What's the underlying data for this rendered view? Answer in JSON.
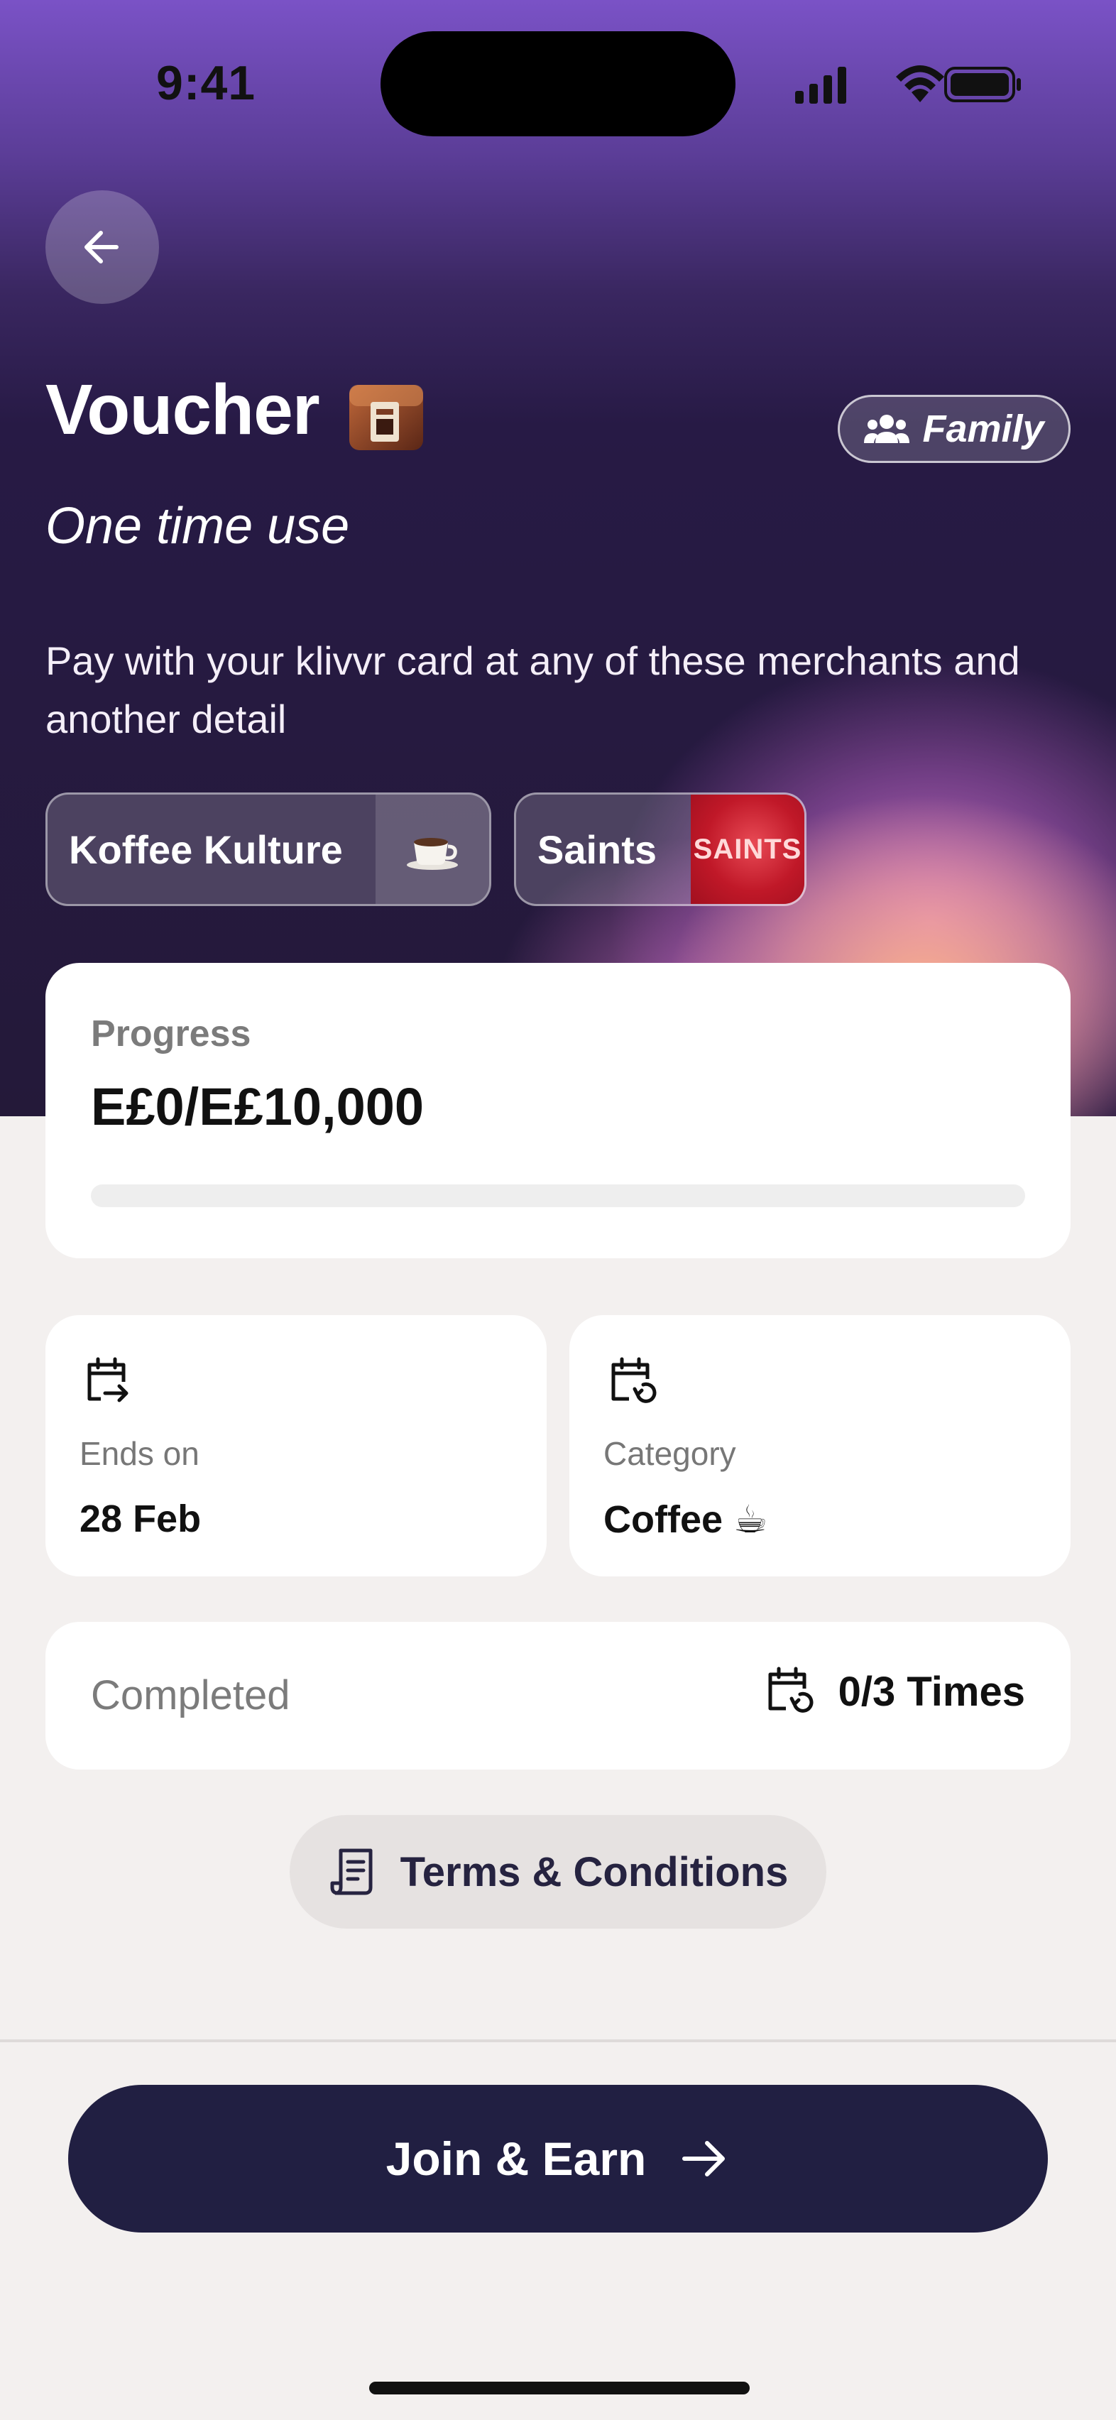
{
  "status_bar": {
    "time": "9:41"
  },
  "header": {
    "title": "Voucher",
    "subtitle": "One time use",
    "family_badge": "Family",
    "description": "Pay with your klivvr card at any of these merchants and another detail"
  },
  "merchants": [
    {
      "name": "Koffee Kulture",
      "thumb_icon": "coffee-cup-icon"
    },
    {
      "name": "Saints",
      "thumb_text": "SAINTS"
    }
  ],
  "progress": {
    "label": "Progress",
    "value_text": "E£0/E£10,000",
    "fraction": 0
  },
  "ends": {
    "label": "Ends on",
    "value": "28 Feb",
    "icon": "calendar-arrow-icon"
  },
  "category": {
    "label": "Category",
    "value": "Coffee ☕",
    "icon": "calendar-repeat-icon"
  },
  "completed": {
    "label": "Completed",
    "value": "0/3 Times",
    "icon": "calendar-repeat-icon"
  },
  "terms": {
    "label": "Terms & Conditions",
    "icon": "receipt-icon"
  },
  "cta": {
    "label": "Join & Earn",
    "icon": "arrow-right-icon"
  },
  "colors": {
    "hero_top": "#7a52c6",
    "hero_bottom": "#241939",
    "cta_bg": "#211f42",
    "page_bg": "#f3f0ef"
  }
}
